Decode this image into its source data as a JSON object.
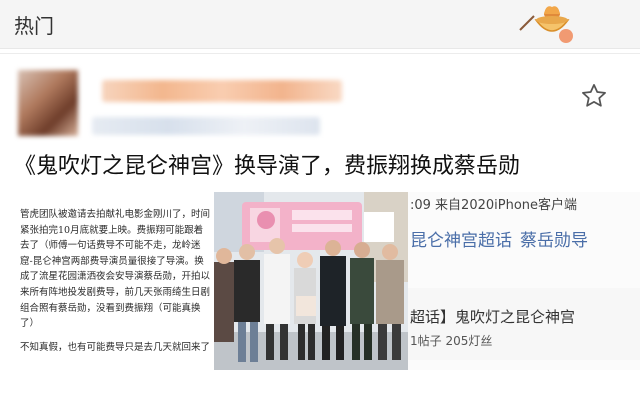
{
  "header": {
    "title": "热门"
  },
  "icons": {
    "bowl": "noodle-bowl-icon",
    "favorite": "star-outline-icon"
  },
  "post": {
    "headline": "《鬼吹灯之昆仑神宫》换导演了，费振翔换成蔡岳勋",
    "body_paragraphs": [
      "管虎团队被邀请去拍献礼电影金刚川了，时间紧张拍完10月底就要上映。费振翔可能跟着去了（师傅一句话费导不可能不走，龙岭迷窟-昆仑神宫两部费导演员量很接了导演。换成了流星花园潇洒夜会安导演蔡岳勋，开拍以来所有阵地投发剧费导，前几天张雨绮生日剧组合照有蔡岳勋，没看到费振翔（可能真换了）",
      "不知真假，也有可能费导只是去几天就回来了"
    ]
  },
  "embedded_screenshot": {
    "device_line": ":09 来自2020iPhone客户端",
    "topic_tag": "昆仑神宫超话",
    "topic_name": "蔡岳勋导",
    "card_title": "超话】鬼吹灯之昆仑神宫",
    "card_stats": "1帖子 205灯丝"
  }
}
